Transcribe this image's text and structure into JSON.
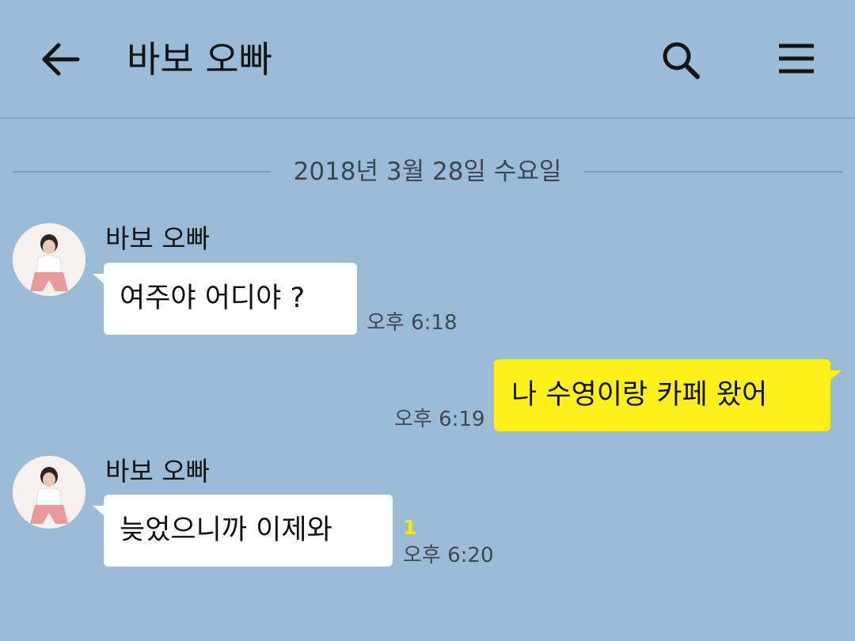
{
  "header": {
    "title": "바보 오빠",
    "back_icon": "arrow-left-icon",
    "search_icon": "search-icon",
    "menu_icon": "hamburger-menu-icon"
  },
  "date_divider": "2018년 3월 28일 수요일",
  "messages": [
    {
      "direction": "incoming",
      "sender": "바보 오빠",
      "text": "여주야 어디야 ?",
      "time": "오후 6:18"
    },
    {
      "direction": "outgoing",
      "text": "나 수영이랑 카페 왔어",
      "time": "오후 6:19"
    },
    {
      "direction": "incoming",
      "sender": "바보 오빠",
      "text": "늦었으니까 이제와",
      "time": "오후 6:20",
      "unread": "1"
    }
  ],
  "colors": {
    "background": "#9cbbd6",
    "incoming_bubble": "#ffffff",
    "outgoing_bubble": "#fef01b",
    "unread_count": "#f4e81c"
  }
}
